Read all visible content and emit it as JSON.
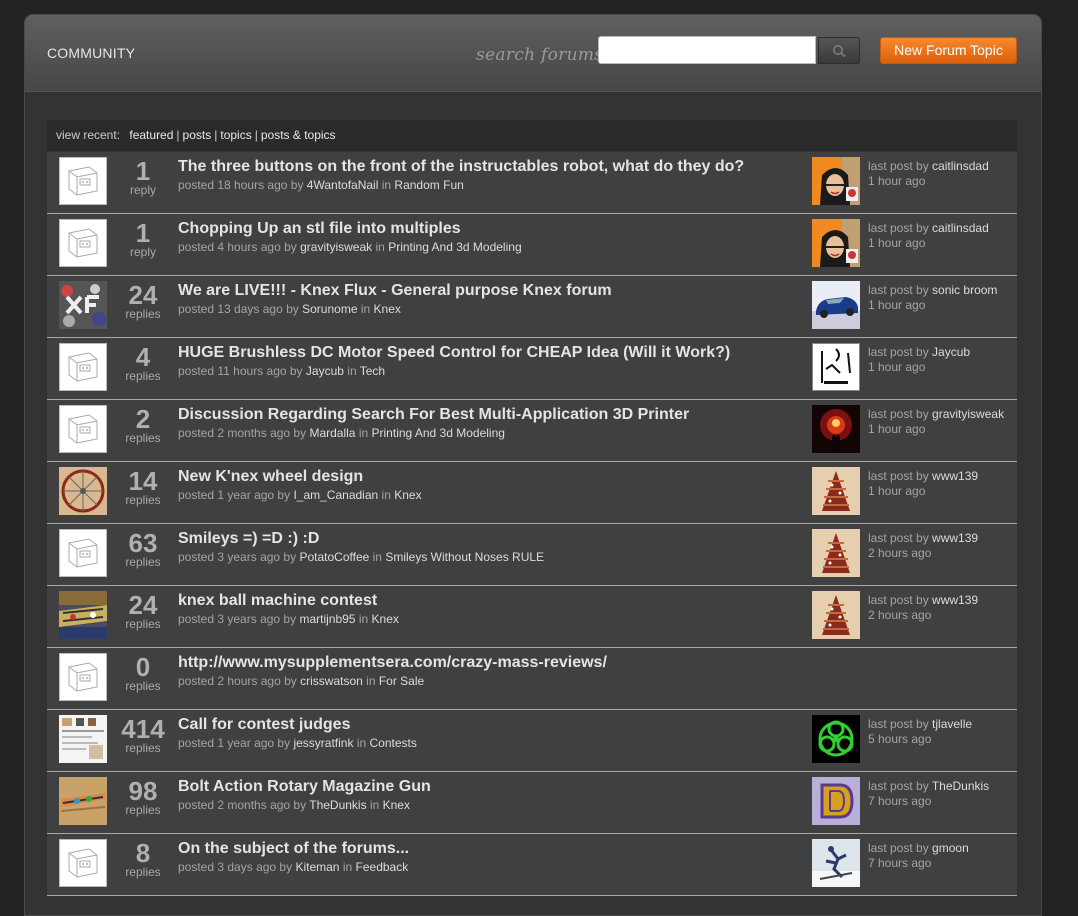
{
  "header": {
    "community": "COMMUNITY",
    "search_label": "search forums:",
    "search_value": "",
    "search_placeholder": "",
    "new_topic": "New Forum Topic"
  },
  "filter": {
    "label": "view recent:",
    "options": [
      "featured",
      "posts",
      "topics",
      "posts & topics"
    ]
  },
  "strings": {
    "posted": "posted",
    "ago_by": "ago by",
    "in": "in",
    "last_post_by": "last post by"
  },
  "topics": [
    {
      "count": "1",
      "unit": "reply",
      "title": "The three buttons on the front of the instructables robot, what do they do?",
      "time": "18 hours",
      "author": "4WantofaNail",
      "category": "Random Fun",
      "last_by": "caitlinsdad",
      "last_time": "1 hour ago",
      "thumb": "robot",
      "avatar": "person"
    },
    {
      "count": "1",
      "unit": "reply",
      "title": "Chopping Up an stl file into multiples",
      "time": "4 hours",
      "author": "gravityisweak",
      "category": "Printing And 3d Modeling",
      "last_by": "caitlinsdad",
      "last_time": "1 hour ago",
      "thumb": "robot",
      "avatar": "person"
    },
    {
      "count": "24",
      "unit": "replies",
      "title": "We are LIVE!!! - Knex Flux - General purpose Knex forum",
      "time": "13 days",
      "author": "Sorunome",
      "category": "Knex",
      "last_by": "sonic broom",
      "last_time": "1 hour ago",
      "thumb": "knex-xf",
      "avatar": "car"
    },
    {
      "count": "4",
      "unit": "replies",
      "title": "HUGE Brushless DC Motor Speed Control for CHEAP Idea (Will it Work?)",
      "time": "11 hours",
      "author": "Jaycub",
      "category": "Tech",
      "last_by": "Jaycub",
      "last_time": "1 hour ago",
      "thumb": "robot",
      "avatar": "sketch"
    },
    {
      "count": "2",
      "unit": "replies",
      "title": "Discussion Regarding Search For Best Multi-Application 3D Printer",
      "time": "2 months",
      "author": "Mardalla",
      "category": "Printing And 3d Modeling",
      "last_by": "gravityisweak",
      "last_time": "1 hour ago",
      "thumb": "robot",
      "avatar": "explosion"
    },
    {
      "count": "14",
      "unit": "replies",
      "title": "New K'nex wheel design",
      "time": "1 year",
      "author": "I_am_Canadian",
      "category": "Knex",
      "last_by": "www139",
      "last_time": "1 hour ago",
      "thumb": "wheel",
      "avatar": "tree"
    },
    {
      "count": "63",
      "unit": "replies",
      "title": "Smileys =) =D :) :D",
      "time": "3 years",
      "author": "PotatoCoffee",
      "category": "Smileys Without Noses RULE",
      "last_by": "www139",
      "last_time": "2 hours ago",
      "thumb": "robot",
      "avatar": "tree"
    },
    {
      "count": "24",
      "unit": "replies",
      "title": "knex ball machine contest",
      "time": "3 years",
      "author": "martijnb95",
      "category": "Knex",
      "last_by": "www139",
      "last_time": "2 hours ago",
      "thumb": "machine",
      "avatar": "tree"
    },
    {
      "count": "0",
      "unit": "replies",
      "title": "http://www.mysupplementsera.com/crazy-mass-reviews/",
      "time": "2 hours",
      "author": "crisswatson",
      "category": "For Sale",
      "last_by": "",
      "last_time": "",
      "thumb": "robot",
      "avatar": "none"
    },
    {
      "count": "414",
      "unit": "replies",
      "title": "Call for contest judges",
      "time": "1 year",
      "author": "jessyratfink",
      "category": "Contests",
      "last_by": "tjlavelle",
      "last_time": "5 hours ago",
      "thumb": "page",
      "avatar": "biohazard"
    },
    {
      "count": "98",
      "unit": "replies",
      "title": "Bolt Action Rotary Magazine Gun",
      "time": "2 months",
      "author": "TheDunkis",
      "category": "Knex",
      "last_by": "TheDunkis",
      "last_time": "7 hours ago",
      "thumb": "gun",
      "avatar": "letter"
    },
    {
      "count": "8",
      "unit": "replies",
      "title": "On the subject of the forums...",
      "time": "3 days",
      "author": "Kiteman",
      "category": "Feedback",
      "last_by": "gmoon",
      "last_time": "7 hours ago",
      "thumb": "robot",
      "avatar": "snow"
    }
  ]
}
